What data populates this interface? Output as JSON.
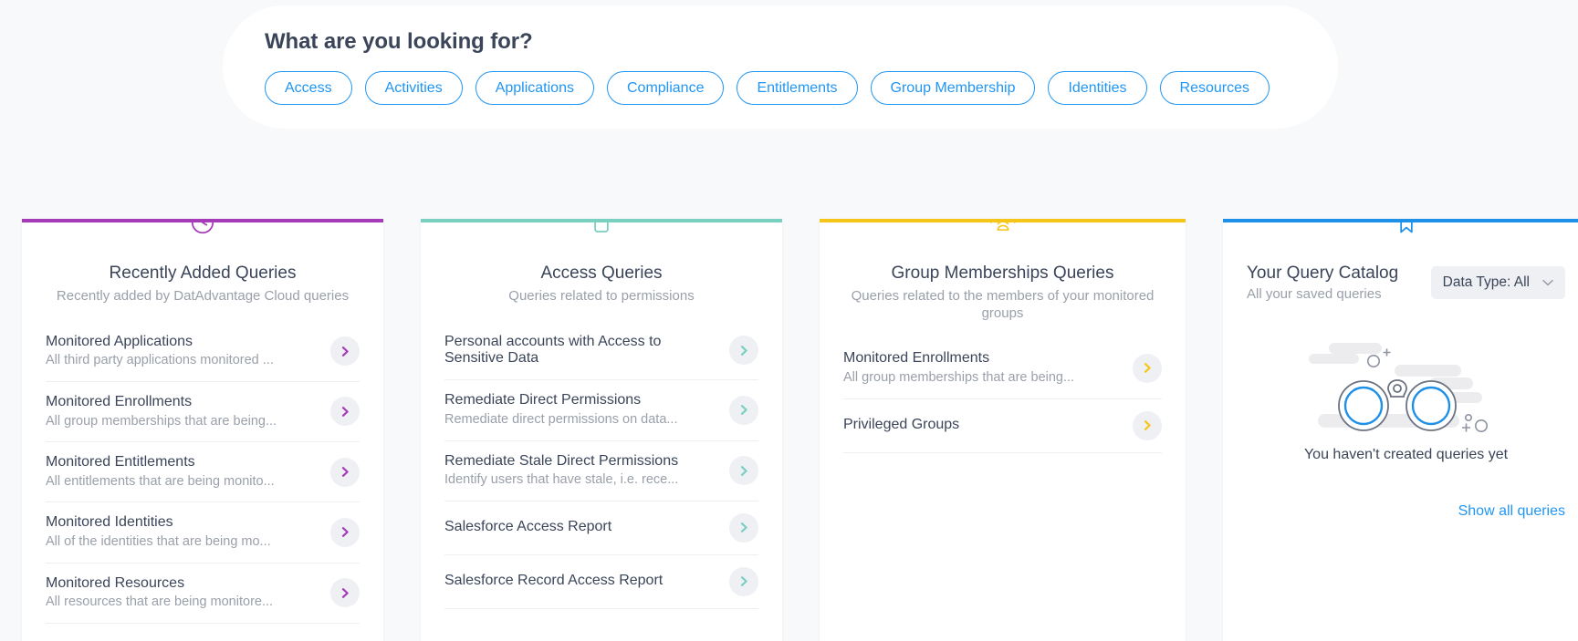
{
  "search": {
    "title": "What are you looking for?",
    "pills": [
      {
        "label": "Access"
      },
      {
        "label": "Activities"
      },
      {
        "label": "Applications"
      },
      {
        "label": "Compliance"
      },
      {
        "label": "Entitlements"
      },
      {
        "label": "Group Membership"
      },
      {
        "label": "Identities"
      },
      {
        "label": "Resources"
      }
    ]
  },
  "cards": [
    {
      "id": "recently-added-queries",
      "icon": "clock-icon",
      "accent": "#a53bb8",
      "title": "Recently Added Queries",
      "subtitle": "Recently added by DatAdvantage Cloud queries",
      "rows": [
        {
          "title": "Monitored Applications",
          "desc": "All third party applications monitored ..."
        },
        {
          "title": "Monitored Enrollments",
          "desc": "All group memberships that are being..."
        },
        {
          "title": "Monitored Entitlements",
          "desc": "All entitlements that are being monito..."
        },
        {
          "title": "Monitored Identities",
          "desc": "All of the identities that are being mo..."
        },
        {
          "title": "Monitored Resources",
          "desc": "All resources that are being monitore..."
        }
      ]
    },
    {
      "id": "access-queries",
      "icon": "unlock-icon",
      "accent": "#79cfc0",
      "title": "Access Queries",
      "subtitle": "Queries related to permissions",
      "rows": [
        {
          "title": "Personal accounts with Access to Sensitive Data",
          "desc": ""
        },
        {
          "title": "Remediate Direct Permissions",
          "desc": "Remediate direct permissions on data..."
        },
        {
          "title": "Remediate Stale Direct Permissions",
          "desc": "Identify users that have stale, i.e. rece..."
        },
        {
          "title": "Salesforce Access Report",
          "desc": ""
        },
        {
          "title": "Salesforce Record Access Report",
          "desc": ""
        }
      ]
    },
    {
      "id": "group-memberships-queries",
      "icon": "group-users-icon",
      "accent": "#f5c518",
      "title": "Group Memberships Queries",
      "subtitle": "Queries related to the members of your monitored groups",
      "rows": [
        {
          "title": "Monitored Enrollments",
          "desc": "All group memberships that are being..."
        },
        {
          "title": "Privileged Groups",
          "desc": ""
        }
      ]
    }
  ],
  "catalog": {
    "id": "your-query-catalog",
    "icon": "bookmark-icon",
    "accent": "#1e90e8",
    "title": "Your Query Catalog",
    "subtitle": "All your saved queries",
    "filter": {
      "label": "Data Type: All",
      "chevron": "chevron-down-icon"
    },
    "empty_illustration": "binoculars-icon",
    "empty_text": "You haven't created queries yet",
    "link_label": "Show all queries"
  }
}
